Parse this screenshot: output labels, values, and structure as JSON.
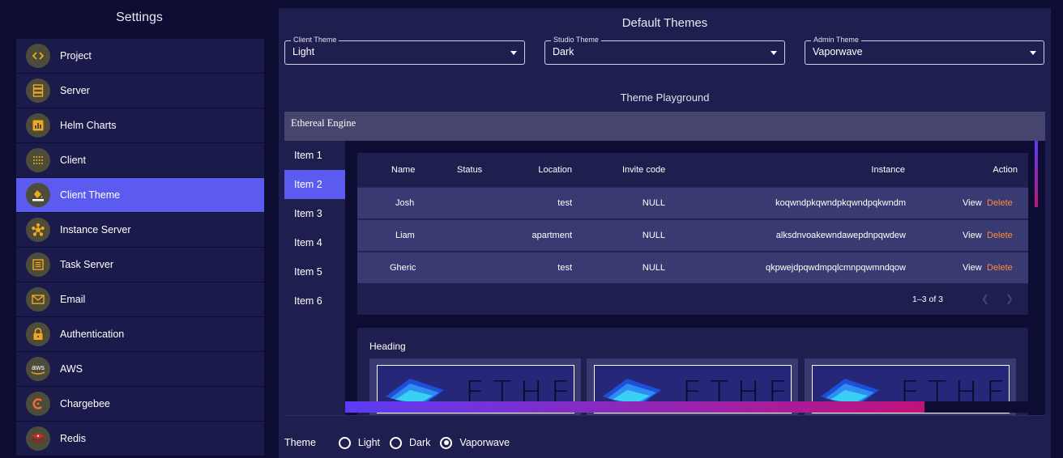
{
  "sidebar": {
    "title": "Settings",
    "items": [
      {
        "label": "Project",
        "icon": "code-icon"
      },
      {
        "label": "Server",
        "icon": "server-icon"
      },
      {
        "label": "Helm Charts",
        "icon": "bar-chart-icon"
      },
      {
        "label": "Client",
        "icon": "grid-icon"
      },
      {
        "label": "Client Theme",
        "icon": "paint-bucket-icon",
        "active": true
      },
      {
        "label": "Instance Server",
        "icon": "hub-icon"
      },
      {
        "label": "Task Server",
        "icon": "list-icon"
      },
      {
        "label": "Email",
        "icon": "mail-icon"
      },
      {
        "label": "Authentication",
        "icon": "lock-icon"
      },
      {
        "label": "AWS",
        "icon": "aws-logo-icon"
      },
      {
        "label": "Chargebee",
        "icon": "chargebee-logo-icon"
      },
      {
        "label": "Redis",
        "icon": "redis-logo-icon"
      }
    ]
  },
  "main": {
    "title": "Default Themes",
    "selects": [
      {
        "legend": "Client Theme",
        "value": "Light"
      },
      {
        "legend": "Studio Theme",
        "value": "Dark"
      },
      {
        "legend": "Admin Theme",
        "value": "Vaporwave"
      }
    ],
    "playground_title": "Theme Playground"
  },
  "playground": {
    "app_title": "Ethereal Engine",
    "nav_items": [
      "Item 1",
      "Item 2",
      "Item 3",
      "Item 4",
      "Item 5",
      "Item 6"
    ],
    "active_nav": "Item 2",
    "table": {
      "headers": {
        "name": "Name",
        "status": "Status",
        "location": "Location",
        "invite": "Invite code",
        "instance": "Instance",
        "action": "Action"
      },
      "rows": [
        {
          "name": "Josh",
          "status": "",
          "location": "test",
          "invite": "NULL",
          "instance": "koqwndpkqwndpkqwndpqkwndm",
          "view": "View",
          "delete": "Delete"
        },
        {
          "name": "Liam",
          "status": "",
          "location": "apartment",
          "invite": "NULL",
          "instance": "alksdnvoakewndawepdnpqwdew",
          "view": "View",
          "delete": "Delete"
        },
        {
          "name": "Gheric",
          "status": "",
          "location": "test",
          "invite": "NULL",
          "instance": "qkpwejdpqwdmpqlcmnpqwmndqow",
          "view": "View",
          "delete": "Delete"
        }
      ],
      "pagination": "1–3 of 3"
    },
    "grid": {
      "heading": "Heading",
      "tile_text": [
        "ETHE",
        "ETHE",
        "ETHE"
      ]
    }
  },
  "theme_selector": {
    "label": "Theme",
    "options": [
      "Light",
      "Dark",
      "Vaporwave"
    ],
    "selected": "Vaporwave"
  },
  "colors": {
    "background": "#0d0d33",
    "panel": "#1f1f4f",
    "sidebar_item": "#1b1b4b",
    "accent": "#5b5bf0",
    "icon_bg": "#4d4c3b",
    "icon_fg": "#f2a81d",
    "delete": "#ff8c3a",
    "gradient_start": "#5b3cf5",
    "gradient_end": "#c2127a"
  }
}
